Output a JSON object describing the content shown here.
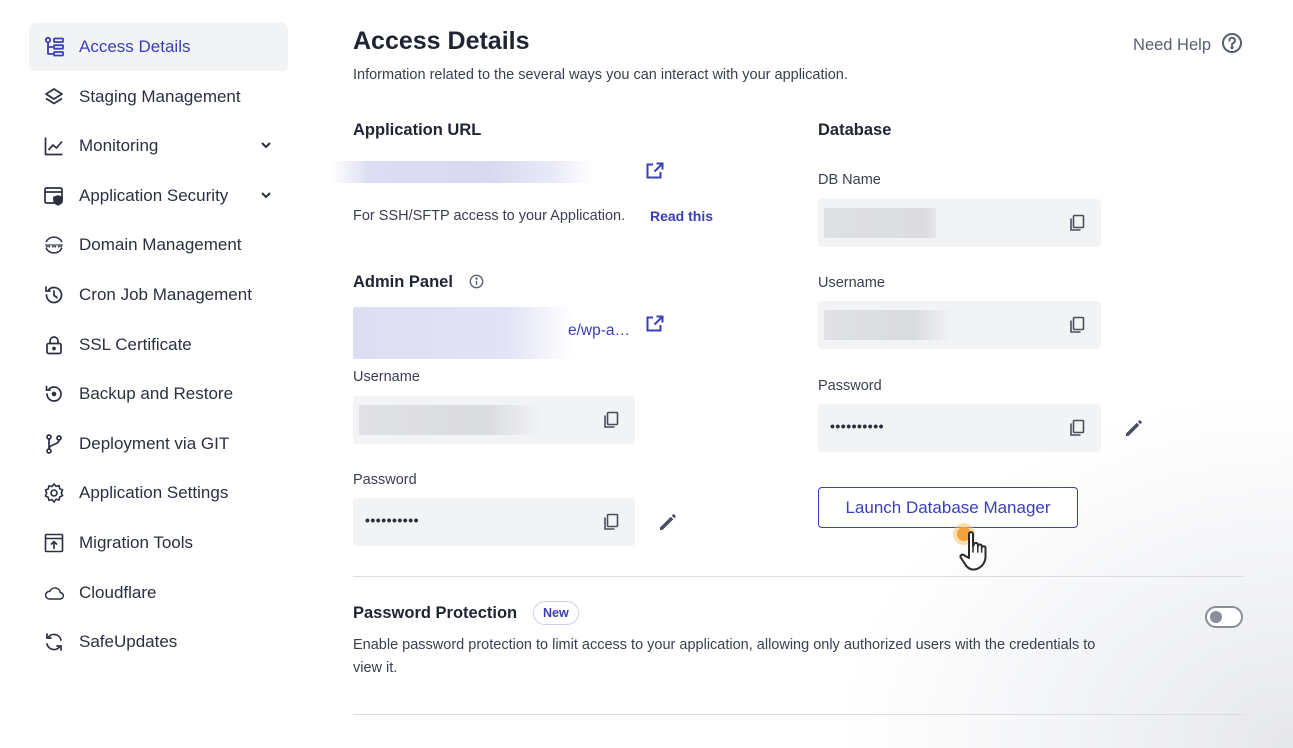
{
  "sidebar": {
    "items": [
      {
        "label": "Access Details",
        "icon": "access-details-icon",
        "active": true
      },
      {
        "label": "Staging Management",
        "icon": "layers-icon"
      },
      {
        "label": "Monitoring",
        "icon": "chart-line-icon",
        "expandable": true
      },
      {
        "label": "Application Security",
        "icon": "security-icon",
        "expandable": true
      },
      {
        "label": "Domain Management",
        "icon": "www-icon"
      },
      {
        "label": "Cron Job Management",
        "icon": "history-clock-icon"
      },
      {
        "label": "SSL Certificate",
        "icon": "lock-icon"
      },
      {
        "label": "Backup and Restore",
        "icon": "backup-restore-icon"
      },
      {
        "label": "Deployment via GIT",
        "icon": "git-branch-icon"
      },
      {
        "label": "Application Settings",
        "icon": "gear-icon"
      },
      {
        "label": "Migration Tools",
        "icon": "migration-icon"
      },
      {
        "label": "Cloudflare",
        "icon": "cloud-icon"
      },
      {
        "label": "SafeUpdates",
        "icon": "refresh-icon"
      }
    ]
  },
  "header": {
    "title": "Access Details",
    "subtitle": "Information related to the several ways you can interact with your application.",
    "help_label": "Need Help"
  },
  "app_url": {
    "title": "Application URL",
    "ssh_note": "For SSH/SFTP access to your Application.",
    "read_this": "Read this"
  },
  "admin_panel": {
    "title": "Admin Panel",
    "url_suffix": "e/wp-a…",
    "username_label": "Username",
    "password_label": "Password",
    "password_mask": "••••••••••"
  },
  "database": {
    "title": "Database",
    "db_name_label": "DB Name",
    "username_label": "Username",
    "password_label": "Password",
    "password_mask": "••••••••••",
    "launch_button": "Launch Database Manager"
  },
  "password_protection": {
    "title": "Password Protection",
    "badge": "New",
    "description": "Enable password protection to limit access to your application, allowing only authorized users with the credentials to view it.",
    "enabled": false
  },
  "colors": {
    "accent": "#3a3fb8",
    "field_bg": "#f2f3f5",
    "text": "#1f2433"
  }
}
